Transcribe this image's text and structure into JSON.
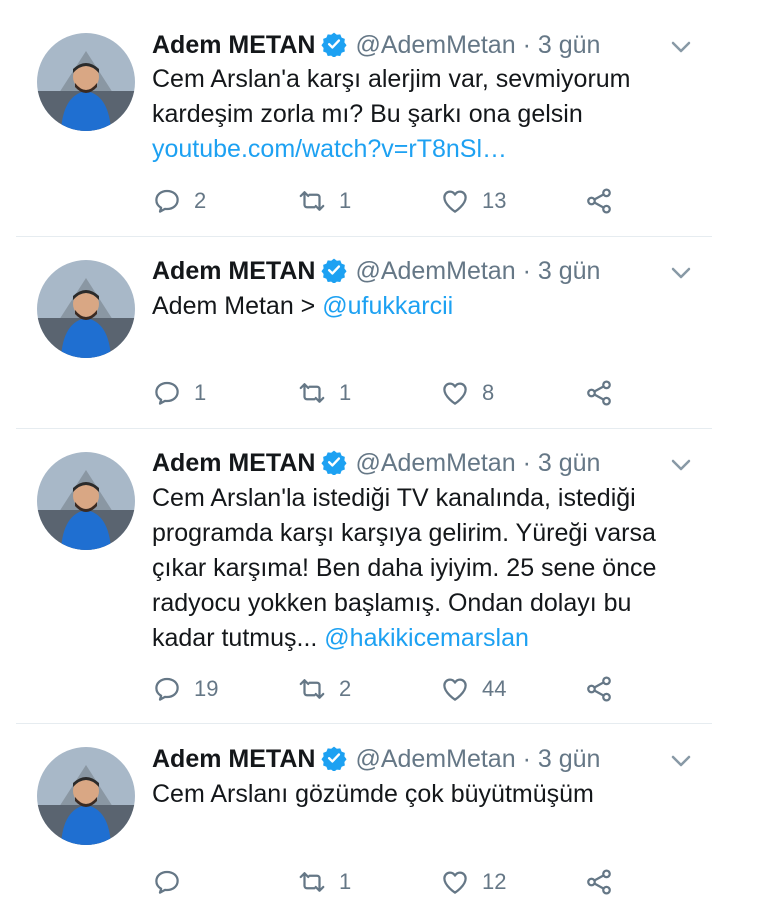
{
  "tweets": [
    {
      "author": "Adem METAN",
      "handle": "@AdemMetan",
      "separator": "·",
      "time": "3 gün",
      "lines": [
        {
          "text": "Cem Arslan'a karşı alerjim var, sevmiyorum",
          "mention": ""
        },
        {
          "text": "kardeşim zorla mı? Bu şarkı ona gelsin",
          "mention": ""
        },
        {
          "text": "",
          "mention": "youtube.com/watch?v=rT8nSl…"
        }
      ],
      "replies": "2",
      "retweets": "1",
      "likes": "13"
    },
    {
      "author": "Adem METAN",
      "handle": "@AdemMetan",
      "separator": "·",
      "time": "3 gün",
      "lines": [
        {
          "text": "Adem Metan > ",
          "mention": "@ufukkarcii"
        }
      ],
      "replies": "1",
      "retweets": "1",
      "likes": "8"
    },
    {
      "author": "Adem METAN",
      "handle": "@AdemMetan",
      "separator": "·",
      "time": "3 gün",
      "lines": [
        {
          "text": "Cem Arslan'la istediği TV kanalında, istediği",
          "mention": ""
        },
        {
          "text": "programda karşı karşıya gelirim. Yüreği varsa",
          "mention": ""
        },
        {
          "text": "çıkar karşıma! Ben daha iyiyim. 25 sene önce",
          "mention": ""
        },
        {
          "text": "radyocu yokken başlamış. Ondan dolayı bu",
          "mention": ""
        },
        {
          "text": "kadar tutmuş... ",
          "mention": "@hakikicemarslan"
        }
      ],
      "replies": "19",
      "retweets": "2",
      "likes": "44"
    },
    {
      "author": "Adem METAN",
      "handle": "@AdemMetan",
      "separator": "·",
      "time": "3 gün",
      "lines": [
        {
          "text": "Cem Arslanı gözümde çok büyütmüşüm",
          "mention": ""
        }
      ],
      "replies": "",
      "retweets": "1",
      "likes": "12"
    }
  ],
  "icons": {
    "reply": "reply-icon",
    "retweet": "retweet-icon",
    "like": "heart-icon",
    "share": "share-icon",
    "verified": "verified-badge-icon",
    "menu": "chevron-down-icon"
  },
  "colors": {
    "text": "#14171a",
    "muted": "#657786",
    "link": "#1da1f2",
    "verified": "#1da1f2",
    "divider": "#e6ecf0"
  }
}
